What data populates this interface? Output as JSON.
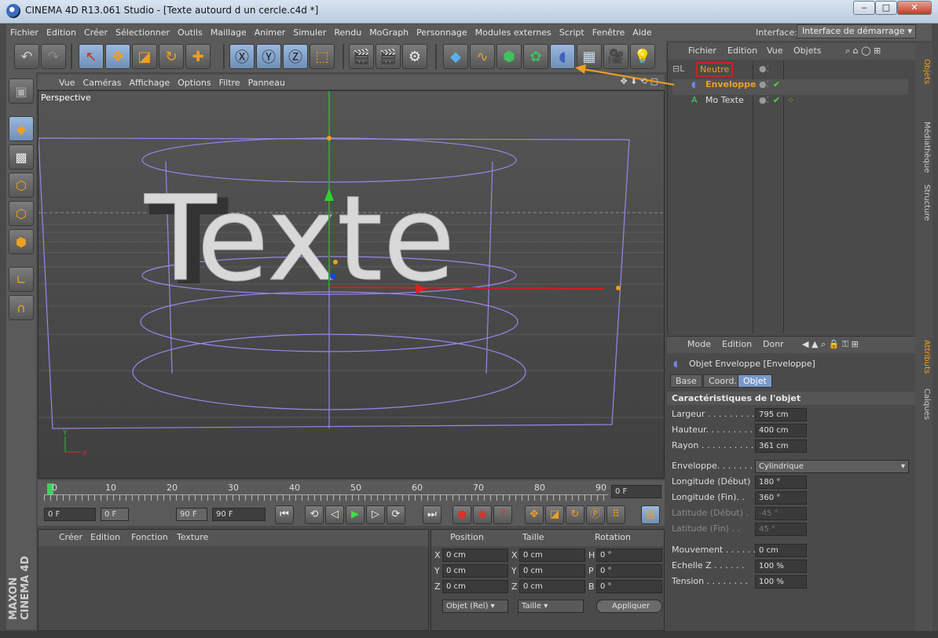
{
  "window": {
    "title": "CINEMA 4D R13.061 Studio - [Texte autourd d un cercle.c4d *]",
    "btn_min": "‒",
    "btn_max": "□",
    "btn_close": "✕"
  },
  "menu": [
    "Fichier",
    "Edition",
    "Créer",
    "Sélectionner",
    "Outils",
    "Maillage",
    "Animer",
    "Simuler",
    "Rendu",
    "MoGraph",
    "Personnage",
    "Modules externes",
    "Script",
    "Fenêtre",
    "Aide"
  ],
  "interface": {
    "label": "Interface:",
    "value": "Interface de démarrage"
  },
  "viewport": {
    "menu": [
      "Vue",
      "Caméras",
      "Affichage",
      "Options",
      "Filtre",
      "Panneau"
    ],
    "label": "Perspective",
    "text3d": "Texte",
    "axis_y": "Y",
    "axis_x": "X"
  },
  "timeline": {
    "ticks": [
      "0",
      "10",
      "20",
      "30",
      "40",
      "50",
      "60",
      "70",
      "80",
      "90"
    ],
    "current": "0 F"
  },
  "transport": {
    "start": "0 F",
    "range_start": "0 F",
    "range_end": "90 F",
    "end": "90 F"
  },
  "material_manager": {
    "menu": [
      "Créer",
      "Edition",
      "Fonction",
      "Texture"
    ]
  },
  "coords": {
    "headers": [
      "Position",
      "Taille",
      "Rotation"
    ],
    "rows": [
      {
        "p_axis": "X",
        "p": "0 cm",
        "s_axis": "X",
        "s": "0 cm",
        "r_axis": "H",
        "r": "0 °"
      },
      {
        "p_axis": "Y",
        "p": "0 cm",
        "s_axis": "Y",
        "s": "0 cm",
        "r_axis": "P",
        "r": "0 °"
      },
      {
        "p_axis": "Z",
        "p": "0 cm",
        "s_axis": "Z",
        "s": "0 cm",
        "r_axis": "B",
        "r": "0 °"
      }
    ],
    "mode": "Objet (Rel)",
    "size_mode": "Taille",
    "apply": "Appliquer"
  },
  "object_manager": {
    "menu": [
      "Fichier",
      "Edition",
      "Vue",
      "Objets"
    ],
    "objects": [
      {
        "name": "Neutre"
      },
      {
        "name": "Enveloppe"
      },
      {
        "name": "Mo Texte"
      }
    ]
  },
  "attributes": {
    "menu": [
      "Mode",
      "Edition",
      "Donr"
    ],
    "object_title": "Objet Enveloppe [Enveloppe]",
    "tabs": [
      "Base",
      "Coord.",
      "Objet"
    ],
    "section": "Caractéristiques de l'objet",
    "props": [
      {
        "label": "Largeur . . . . . . . . .",
        "value": "795 cm"
      },
      {
        "label": "Hauteur. . . . . . . . .",
        "value": "400 cm"
      },
      {
        "label": "Rayon . . . . . . . . . .",
        "value": "361 cm"
      }
    ],
    "deform": {
      "label": "Enveloppe. . . . . . . .",
      "value": "Cylindrique"
    },
    "angles": [
      {
        "label": "Longitude (Début)",
        "value": "180 °"
      },
      {
        "label": "Longitude (Fin). .",
        "value": "360 °"
      },
      {
        "label": "Latitude (Début) .",
        "value": "-45 °"
      },
      {
        "label": "Latitude (Fin) . .",
        "value": "45 °"
      }
    ],
    "extras": [
      {
        "label": "Mouvement . . . . . .",
        "value": "0 cm"
      },
      {
        "label": "Echelle Z . . . . . .",
        "value": "100 %"
      },
      {
        "label": "Tension . . . . . . . .",
        "value": "100 %"
      }
    ]
  },
  "side_tabs": [
    "Objets",
    "Médiathèque",
    "Structure",
    "Attributs",
    "Calques"
  ],
  "branding": "MAXON CINEMA 4D",
  "colors": {
    "accent_orange": "#f0a020",
    "selection_blue": "#6f8fb8",
    "highlight_red": "#cc2020"
  }
}
